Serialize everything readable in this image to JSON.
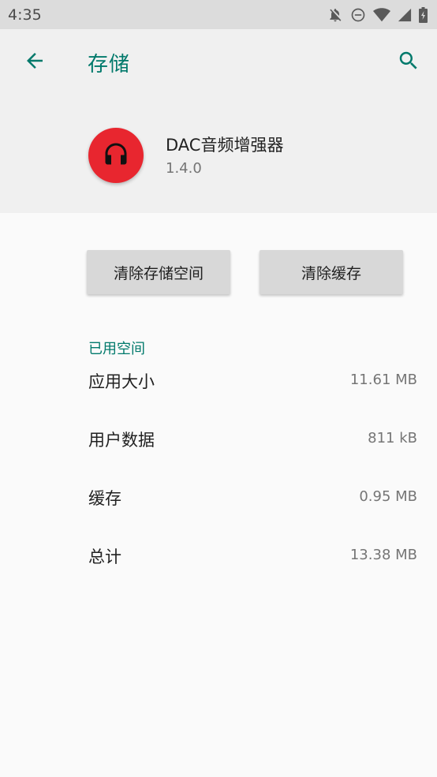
{
  "status_bar": {
    "time": "4:35",
    "icons": [
      "notifications-off-icon",
      "do-not-disturb-icon",
      "wifi-icon",
      "cellular-signal-icon",
      "battery-charging-icon"
    ]
  },
  "toolbar": {
    "title": "存储",
    "back_icon": "arrow-back-icon",
    "search_icon": "search-icon",
    "accent_color": "#00796b"
  },
  "app": {
    "name": "DAC音频增强器",
    "version": "1.4.0",
    "icon": "headphones-icon",
    "icon_color": "#e8262f"
  },
  "actions": {
    "clear_storage_label": "清除存储空间",
    "clear_cache_label": "清除缓存"
  },
  "storage": {
    "section_title": "已用空间",
    "rows": [
      {
        "label": "应用大小",
        "value": "11.61 MB"
      },
      {
        "label": "用户数据",
        "value": "811 kB"
      },
      {
        "label": "缓存",
        "value": "0.95 MB"
      },
      {
        "label": "总计",
        "value": "13.38 MB"
      }
    ]
  }
}
